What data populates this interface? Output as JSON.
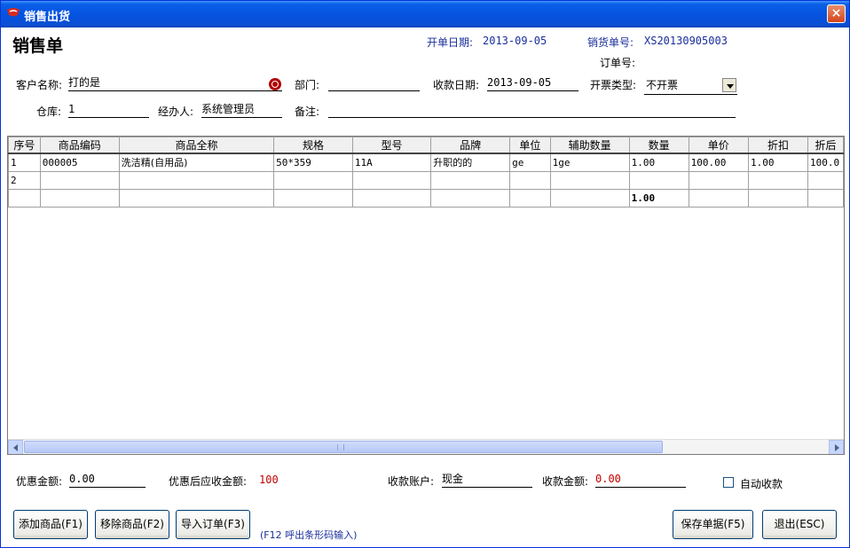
{
  "window": {
    "title": "销售出货",
    "close_label": "×"
  },
  "form": {
    "heading": "销售单",
    "open_date_label": "开单日期:",
    "open_date": "2013-09-05",
    "sale_no_label": "销货单号:",
    "sale_no": "XS20130905003",
    "order_no_label": "订单号:",
    "order_no": "",
    "customer_label": "客户名称:",
    "customer": "打的是",
    "department_label": "部门:",
    "department": "",
    "receipt_date_label": "收款日期:",
    "receipt_date": "2013-09-05",
    "invoice_type_label": "开票类型:",
    "invoice_type": "不开票",
    "warehouse_label": "仓库:",
    "warehouse": "1",
    "handler_label": "经办人:",
    "handler": "系统管理员",
    "remark_label": "备注:",
    "remark": ""
  },
  "grid": {
    "columns": [
      "序号",
      "商品编码",
      "商品全称",
      "规格",
      "型号",
      "品牌",
      "单位",
      "辅助数量",
      "数量",
      "单价",
      "折扣",
      "折后"
    ],
    "rows": [
      [
        "1",
        "000005",
        "洗洁精(自用品)",
        "50*359",
        "11A",
        "升职的的",
        "ge",
        "1ge",
        "1.00",
        "100.00",
        "1.00",
        "100.0"
      ],
      [
        "2",
        "",
        "",
        "",
        "",
        "",
        "",
        "",
        "",
        "",
        "",
        ""
      ]
    ],
    "summary": [
      "",
      "",
      "",
      "",
      "",
      "",
      "",
      "",
      "1.00",
      "",
      "",
      ""
    ]
  },
  "footer": {
    "discount_label": "优惠金额:",
    "discount": "0.00",
    "receivable_label": "优惠后应收金额:",
    "receivable": "100",
    "account_label": "收款账户:",
    "account": "现金",
    "amount_label": "收款金额:",
    "amount": "0.00",
    "auto_receipt_label": "自动收款"
  },
  "buttons": {
    "add": "添加商品(F1)",
    "remove": "移除商品(F2)",
    "import": "导入订单(F3)",
    "save": "保存单据(F5)",
    "exit": "退出(ESC)"
  },
  "hint": "(F12 呼出条形码输入)",
  "colors": {
    "titlebar": "#0553e1",
    "label_blue": "#1a2e9c",
    "accent_red": "#c00000"
  }
}
